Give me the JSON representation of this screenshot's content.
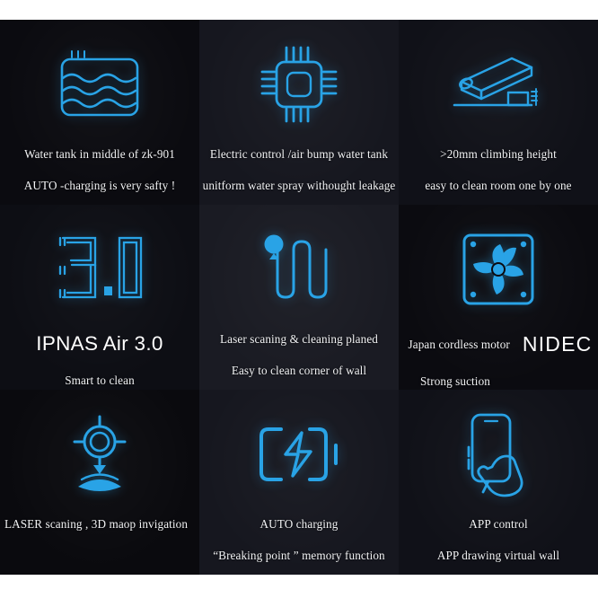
{
  "layout": {
    "columns": 3,
    "rows": 3,
    "background_color": "#ffffff",
    "tile_background_color": "#0b0b10",
    "icon_color": "#29a3e6",
    "text_color": "#f2f3f5"
  },
  "cells": [
    {
      "id": "water-tank",
      "icon": "water-tank-icon",
      "lines": [
        "Water tank in middle of  zk-901",
        "AUTO -charging is very safty !"
      ]
    },
    {
      "id": "electric-control",
      "icon": "cpu-chip-icon",
      "lines": [
        "Electric control /air bump water tank",
        "unitform water spray withought leakage"
      ]
    },
    {
      "id": "climbing-height",
      "icon": "climbing-ramp-icon",
      "lines": [
        ">20mm climbing height",
        "easy to clean room one by one"
      ]
    },
    {
      "id": "ipnas-air",
      "icon": "three-point-zero-icon",
      "brand_title": "IPNAS Air  3.0",
      "lines": [
        "Smart to clean"
      ]
    },
    {
      "id": "laser-scanning-path",
      "icon": "cleaning-path-icon",
      "lines": [
        "Laser scaning  & cleaning planed",
        "Easy to clean corner of wall"
      ]
    },
    {
      "id": "cordless-motor",
      "icon": "fan-motor-icon",
      "motor_label": "Japan cordless motor",
      "brand_logo": "NIDEC",
      "lines": [
        "Strong suction"
      ]
    },
    {
      "id": "laser-navigation",
      "icon": "laser-navigation-icon",
      "lines": [
        "LASER scaning  , 3D maop  invigation"
      ]
    },
    {
      "id": "auto-charging",
      "icon": "battery-charging-icon",
      "lines": [
        "AUTO charging",
        "“Breaking point ” memory function"
      ]
    },
    {
      "id": "app-control",
      "icon": "phone-in-hand-icon",
      "lines": [
        "APP control",
        "APP drawing virtual wall"
      ]
    }
  ]
}
